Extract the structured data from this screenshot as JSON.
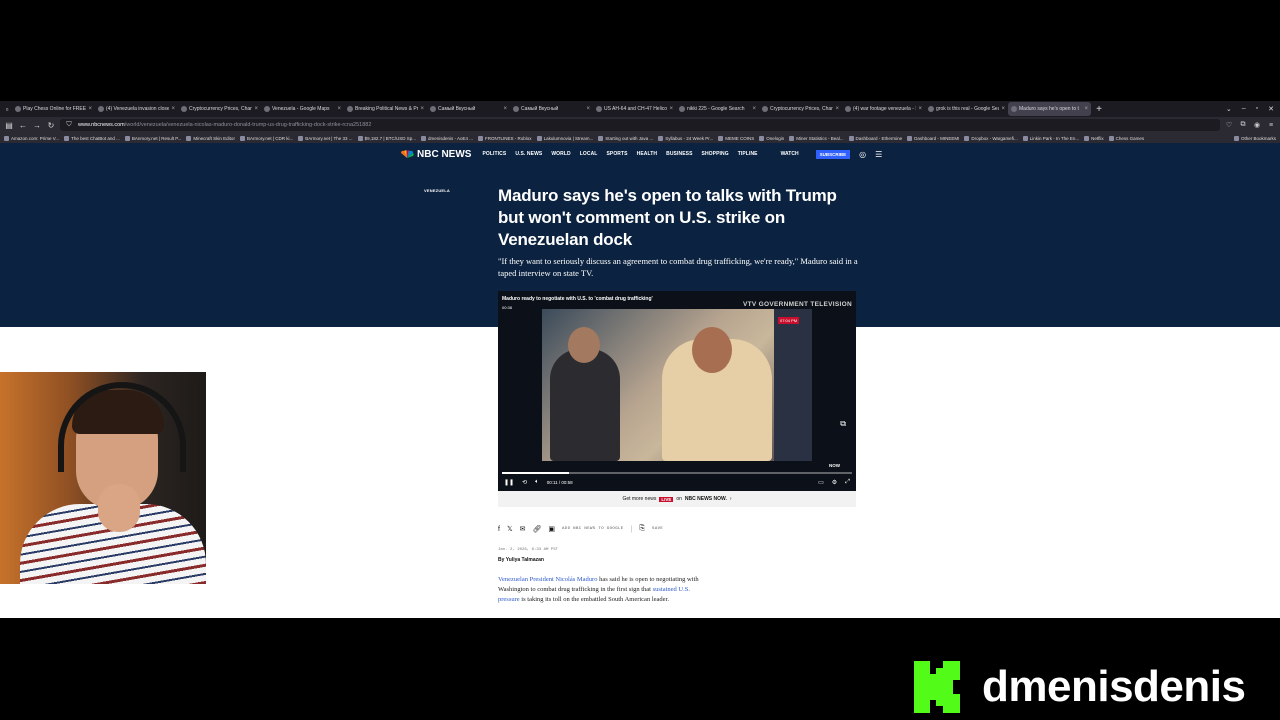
{
  "browser": {
    "tabs": [
      {
        "title": "Play Chess Online for FREE - 2"
      },
      {
        "title": "(4) Venezuela invasion close up"
      },
      {
        "title": "Cryptocurrency Prices, Charts A"
      },
      {
        "title": "Venezuela - Google Maps"
      },
      {
        "title": "Breaking Political News & Predi"
      },
      {
        "title": "Самый Вкусный"
      },
      {
        "title": "Самый Вкусный"
      },
      {
        "title": "US AH-64 and CH-47 Helicopte"
      },
      {
        "title": "nikki 225 - Google Search"
      },
      {
        "title": "Cryptocurrency Prices, Charts A"
      },
      {
        "title": "(4) war footage venezuela - Se"
      },
      {
        "title": "grok is this real - Google Search"
      },
      {
        "title": "Maduro says he's open to t"
      }
    ],
    "url_domain": "www.nbcnews.com",
    "url_path": "/world/venezuela/venezuela-nicolas-maduro-donald-trump-us-drug-trafficking-dock-strike-rcna251882",
    "bookmarks": [
      "Amazon.com: Prime V...",
      "The best ChatBot and ...",
      "BAnmory.net | Result P...",
      "Minecraft Skin Editor",
      "BArmory.net | CDR ki...",
      "BArmory.net | The 33 ...",
      "$9,182.7 | BTC/USD Sp...",
      "dmenisdenis - AoE4 ...",
      "FRONTLINES - Roblox",
      "Lakulumnovia | Stream...",
      "Starting out with Java ...",
      "Syllabus - 24 Week Pr...",
      "MEME COINS",
      "Onelogin",
      "Miner Statistics - Beal...",
      "Dashboard - Ethermine",
      "Dashboard - MINEEMI",
      "Dropbox - Wargamefi...",
      "Linkin Park - In The En...",
      "Netflix",
      "Chess Games"
    ],
    "bookmarks_other": "Other Bookmarks"
  },
  "site": {
    "logo": "NBC NEWS",
    "nav": [
      "POLITICS",
      "U.S. NEWS",
      "WORLD",
      "LOCAL",
      "SPORTS",
      "HEALTH",
      "BUSINESS",
      "SHOPPING",
      "TIPLINE"
    ],
    "watch": "WATCH",
    "subscribe": "SUBSCRIBE"
  },
  "article": {
    "section": "VENEZUELA",
    "headline": "Maduro says he's open to talks with Trump but won't comment on U.S. strike on Venezuelan dock",
    "dek": "\"If they want to seriously discuss an agreement to combat drug trafficking, we're ready,\" Maduro said in a taped interview on state TV.",
    "share": {
      "google": "ADD NBC NEWS TO GOOGLE",
      "save": "SAVE"
    },
    "date": "Jan. 2, 2026, 6:33 AM PST",
    "byline": "By Yuliya Talmazan",
    "body_link1": "Venezuelan President Nicolás Maduro",
    "body_text1": " has said he is open to negotiating with Washington to combat drug trafficking in the first sign that ",
    "body_link2": "sustained U.S. pressure",
    "body_text2": " is taking its toll on the embattled South American leader."
  },
  "video": {
    "title": "Maduro ready to negotiate with U.S. to 'combat drug trafficking'",
    "time_top": "00:38",
    "source": "VTV GOVERNMENT TELEVISION",
    "badge_time": "07:04 PM",
    "watermark": "NOW",
    "time": "00:11 / 00:58",
    "progress": 0.19
  },
  "promo": {
    "prefix": "Get more news",
    "live": "LIVE",
    "on": "on",
    "channel": "NBC NEWS NOW."
  },
  "overlay": {
    "streamer": "dmenisdenis"
  }
}
